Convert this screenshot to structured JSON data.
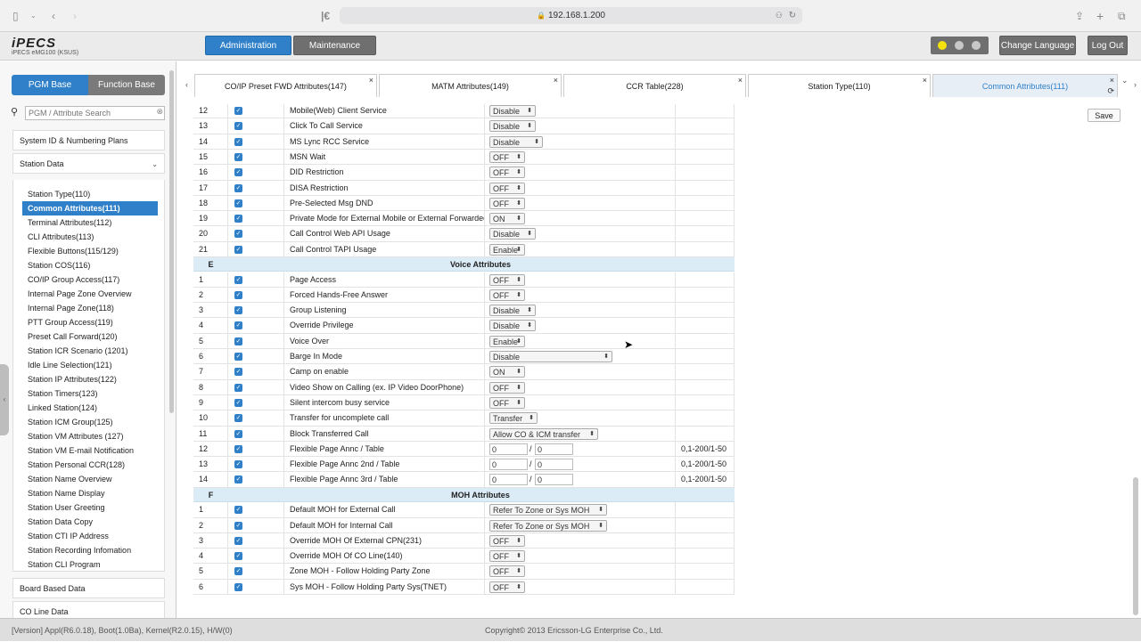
{
  "browser": {
    "url": "192.168.1.200"
  },
  "app": {
    "logo": "iPECS",
    "subtitle": "iPECS eMG100 (KSUS)",
    "admin_label": "Administration",
    "maint_label": "Maintenance",
    "lang_label": "Change Language",
    "logout_label": "Log Out"
  },
  "sidebar": {
    "tab_pgm": "PGM Base",
    "tab_func": "Function Base",
    "search_placeholder": "PGM / Attribute Search",
    "sections": [
      "System ID & Numbering Plans",
      "Station Data",
      "Board Based Data",
      "CO Line Data"
    ],
    "items": [
      "Station Type(110)",
      "Common Attributes(111)",
      "Terminal Attributes(112)",
      "CLI Attributes(113)",
      "Flexible Buttons(115/129)",
      "Station COS(116)",
      "CO/IP Group Access(117)",
      "Internal Page Zone Overview",
      "Internal Page Zone(118)",
      "PTT Group Access(119)",
      "Preset Call Forward(120)",
      "Station ICR Scenario (1201)",
      "Idle Line Selection(121)",
      "Station IP Attributes(122)",
      "Station Timers(123)",
      "Linked Station(124)",
      "Station ICM Group(125)",
      "Station VM Attributes (127)",
      "Station VM E-mail Notification",
      "Station Personal CCR(128)",
      "Station Name Overview",
      "Station Name Display",
      "Station User Greeting",
      "Station Data Copy",
      "Station CTI IP Address",
      "Station Recording Infomation",
      "Station CLI Program"
    ],
    "active_index": 1
  },
  "tabs": [
    "CO/IP Preset FWD Attributes(147)",
    "MATM Attributes(149)",
    "CCR Table(228)",
    "Station Type(110)",
    "Common Attributes(111)"
  ],
  "save_label": "Save",
  "table": {
    "rows_d": [
      {
        "n": "12",
        "name": "Mobile(Web) Client Service",
        "val": "Disable"
      },
      {
        "n": "13",
        "name": "Click To Call Service",
        "val": "Disable"
      },
      {
        "n": "14",
        "name": "MS Lync RCC Service",
        "val": "Disable"
      },
      {
        "n": "15",
        "name": "MSN Wait",
        "val": "OFF"
      },
      {
        "n": "16",
        "name": "DID Restriction",
        "val": "OFF"
      },
      {
        "n": "17",
        "name": "DISA Restriction",
        "val": "OFF"
      },
      {
        "n": "18",
        "name": "Pre-Selected Msg DND",
        "val": "OFF"
      },
      {
        "n": "19",
        "name": "Private Mode for External Mobile or External Forwarded",
        "val": "ON"
      },
      {
        "n": "20",
        "name": "Call Control Web API Usage",
        "val": "Disable"
      },
      {
        "n": "21",
        "name": "Call Control TAPI Usage",
        "val": "Enable"
      }
    ],
    "section_e": {
      "letter": "E",
      "title": "Voice Attributes"
    },
    "rows_e": [
      {
        "n": "1",
        "name": "Page Access",
        "val": "OFF"
      },
      {
        "n": "2",
        "name": "Forced Hands-Free Answer",
        "val": "OFF"
      },
      {
        "n": "3",
        "name": "Group Listening",
        "val": "Disable"
      },
      {
        "n": "4",
        "name": "Override Privilege",
        "val": "Disable"
      },
      {
        "n": "5",
        "name": "Voice Over",
        "val": "Enable"
      },
      {
        "n": "6",
        "name": "Barge In Mode",
        "val": "Disable"
      },
      {
        "n": "7",
        "name": "Camp on enable",
        "val": "ON"
      },
      {
        "n": "8",
        "name": "Video Show on Calling (ex. IP Video DoorPhone)",
        "val": "OFF"
      },
      {
        "n": "9",
        "name": "Silent intercom busy service",
        "val": "OFF"
      },
      {
        "n": "10",
        "name": "Transfer for uncomplete call",
        "val": "Transfer"
      },
      {
        "n": "11",
        "name": "Block Transferred Call",
        "val": "Allow CO & ICM transfer"
      },
      {
        "n": "12",
        "name": "Flexible Page Annc / Table",
        "a": "0",
        "b": "0",
        "range": "0,1-200/1-50"
      },
      {
        "n": "13",
        "name": "Flexible Page Annc 2nd / Table",
        "a": "0",
        "b": "0",
        "range": "0,1-200/1-50"
      },
      {
        "n": "14",
        "name": "Flexible Page Annc 3rd / Table",
        "a": "0",
        "b": "0",
        "range": "0,1-200/1-50"
      }
    ],
    "section_f": {
      "letter": "F",
      "title": "MOH Attributes"
    },
    "rows_f": [
      {
        "n": "1",
        "name": "Default MOH for External Call",
        "val": "Refer To Zone or Sys MOH"
      },
      {
        "n": "2",
        "name": "Default MOH for Internal Call",
        "val": "Refer To Zone or Sys MOH"
      },
      {
        "n": "3",
        "name": "Override MOH Of External CPN(231)",
        "val": "OFF"
      },
      {
        "n": "4",
        "name": "Override MOH Of CO Line(140)",
        "val": "OFF"
      },
      {
        "n": "5",
        "name": "Zone MOH - Follow Holding Party Zone",
        "val": "OFF"
      },
      {
        "n": "6",
        "name": "Sys MOH - Follow Holding Party Sys(TNET)",
        "val": "OFF"
      }
    ]
  },
  "status": {
    "version": "[Version] Appl(R6.0.18), Boot(1.0Ba), Kernel(R2.0.15), H/W(0)",
    "copyright": "Copyright© 2013 Ericsson-LG Enterprise Co., Ltd."
  },
  "colors": {
    "accent": "#2f80c9",
    "section_bg": "#dbecf7"
  },
  "icons": [
    "sidebar-toggle-icon",
    "back-icon",
    "forward-icon",
    "lock-icon",
    "reload-icon",
    "share-icon",
    "new-tab-icon",
    "tabs-icon",
    "search-icon",
    "clear-icon",
    "chevron-down-icon",
    "close-icon",
    "checkbox-checked-icon",
    "select-arrow-icon"
  ]
}
